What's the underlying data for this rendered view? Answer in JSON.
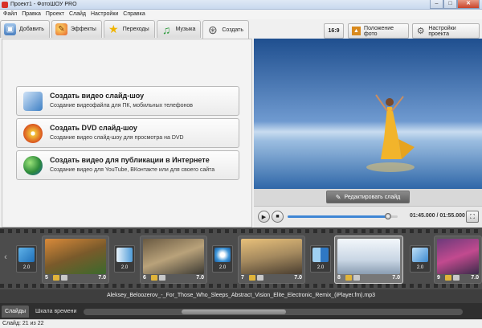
{
  "window": {
    "title": "Проект1 - ФотоШОУ PRO"
  },
  "menu": [
    "Файл",
    "Правка",
    "Проект",
    "Слайд",
    "Настройки",
    "Справка"
  ],
  "tabs": [
    {
      "label": "Добавить",
      "icon": "add-photos-icon"
    },
    {
      "label": "Эффекты",
      "icon": "effects-palette-icon"
    },
    {
      "label": "Переходы",
      "icon": "star-transitions-icon"
    },
    {
      "label": "Музыка",
      "icon": "music-note-icon"
    },
    {
      "label": "Создать",
      "icon": "film-reel-icon",
      "active": true
    }
  ],
  "toolbar": {
    "aspect_label": "16:9",
    "photo_position_label": "Положение фото",
    "project_settings_label": "Настройки проекта"
  },
  "create_options": [
    {
      "title": "Создать видео слайд-шоу",
      "subtitle": "Создание видеофайла для ПК, мобильных телефонов",
      "icon": "video-device-icon"
    },
    {
      "title": "Создать DVD слайд-шоу",
      "subtitle": "Создание видео слайд-шоу для просмотра на DVD",
      "icon": "dvd-disc-icon"
    },
    {
      "title": "Создать видео для публикации в Интернете",
      "subtitle": "Создание видео для YouTube, ВКонтакте или для своего сайта",
      "icon": "globe-icon"
    }
  ],
  "preview": {
    "edit_slide_label": "Редактировать слайд"
  },
  "player": {
    "time": "01:45.000 / 01:55.000",
    "progress": 0.913
  },
  "filmstrip": {
    "transitions": [
      "2.0",
      "2.0",
      "2.0",
      "2.0",
      "2.0"
    ],
    "slides": [
      {
        "number": "5",
        "duration": "7.0"
      },
      {
        "number": "6",
        "duration": "7.0"
      },
      {
        "number": "7",
        "duration": "7.0"
      },
      {
        "number": "8",
        "duration": "7.0",
        "selected": true
      },
      {
        "number": "9",
        "duration": "7.0"
      }
    ]
  },
  "audio": {
    "track_name": "Aleksey_Beloozerov_-_For_Those_Who_Sleeps_Abstract_Vision_Elite_Electronic_Remix_(iPlayer.fm).mp3"
  },
  "bottom_tabs": [
    "Слайды",
    "Шкала времени"
  ],
  "status": {
    "text": "Слайд: 21 из 22"
  }
}
